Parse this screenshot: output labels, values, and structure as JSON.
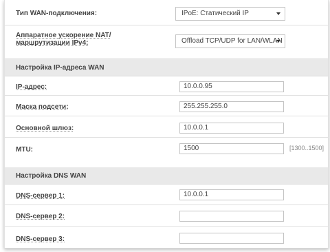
{
  "wan_type": {
    "label": "Тип WAN-подключения:",
    "value": "IPoE: Статический IP"
  },
  "nat_accel": {
    "label_line1": "Аппаратное ускорение NAT/",
    "label_line2": "маршрутизации IPv4:",
    "value": "Offload TCP/UDP for LAN/WLAN"
  },
  "ip_section": {
    "title": "Настройка IP-адреса WAN",
    "ip_address": {
      "label": "IP-адрес:",
      "value": "10.0.0.95"
    },
    "subnet_mask": {
      "label": "Маска подсети:",
      "value": "255.255.255.0"
    },
    "gateway": {
      "label": "Основной шлюз:",
      "value": "10.0.0.1"
    },
    "mtu": {
      "label": "MTU:",
      "value": "1500",
      "hint": "[1300..1500]"
    }
  },
  "dns_section": {
    "title": "Настройка DNS WAN",
    "dns1": {
      "label": "DNS-сервер 1:",
      "value": "10.0.0.1"
    },
    "dns2": {
      "label": "DNS-сервер 2:",
      "value": ""
    },
    "dns3": {
      "label": "DNS-сервер 3:",
      "value": ""
    }
  }
}
